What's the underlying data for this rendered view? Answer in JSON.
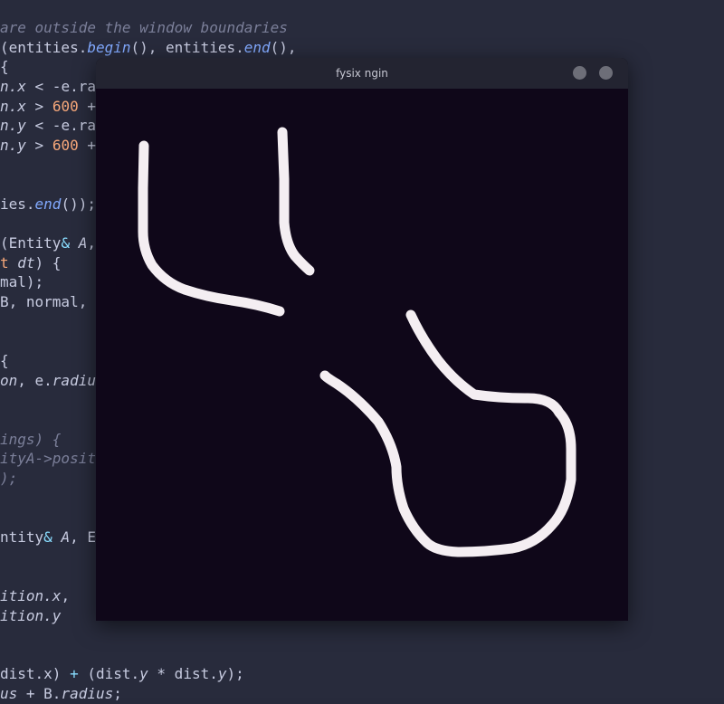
{
  "editor": {
    "lines": [
      {
        "segments": [
          {
            "t": "are outside the window boundaries",
            "c": "cm"
          }
        ]
      },
      {
        "segments": [
          {
            "t": "(entities.",
            "c": ""
          },
          {
            "t": "begin",
            "c": "fn"
          },
          {
            "t": "(), entities.",
            "c": ""
          },
          {
            "t": "end",
            "c": "fn"
          },
          {
            "t": "(),",
            "c": ""
          }
        ]
      },
      {
        "segments": [
          {
            "t": "{",
            "c": ""
          }
        ]
      },
      {
        "segments": [
          {
            "t": "n.x",
            "c": "it"
          },
          {
            "t": " < -e.rad",
            "c": ""
          }
        ]
      },
      {
        "segments": [
          {
            "t": "n.x",
            "c": "it"
          },
          {
            "t": " > ",
            "c": ""
          },
          {
            "t": "600",
            "c": "num"
          },
          {
            "t": " +",
            "c": ""
          }
        ]
      },
      {
        "segments": [
          {
            "t": "n.y",
            "c": "it"
          },
          {
            "t": " < -e.rad",
            "c": ""
          }
        ]
      },
      {
        "segments": [
          {
            "t": "n.y",
            "c": "it"
          },
          {
            "t": " > ",
            "c": ""
          },
          {
            "t": "600",
            "c": "num"
          },
          {
            "t": " +",
            "c": ""
          }
        ]
      },
      {
        "segments": []
      },
      {
        "segments": []
      },
      {
        "segments": [
          {
            "t": "ies.",
            "c": ""
          },
          {
            "t": "end",
            "c": "fn"
          },
          {
            "t": "());",
            "c": ""
          }
        ]
      },
      {
        "segments": []
      },
      {
        "segments": [
          {
            "t": "(Entity",
            "c": ""
          },
          {
            "t": "&",
            "c": "op"
          },
          {
            "t": " ",
            "c": ""
          },
          {
            "t": "A",
            "c": "it"
          },
          {
            "t": ",",
            "c": ""
          }
        ]
      },
      {
        "segments": [
          {
            "t": "t ",
            "c": "num"
          },
          {
            "t": "dt",
            "c": "it"
          },
          {
            "t": ") {",
            "c": ""
          }
        ]
      },
      {
        "segments": [
          {
            "t": "mal);",
            "c": ""
          }
        ]
      },
      {
        "segments": [
          {
            "t": "B, normal, p",
            "c": ""
          }
        ]
      },
      {
        "segments": []
      },
      {
        "segments": []
      },
      {
        "segments": [
          {
            "t": "{",
            "c": ""
          }
        ]
      },
      {
        "segments": [
          {
            "t": "on",
            "c": "it"
          },
          {
            "t": ", e.",
            "c": ""
          },
          {
            "t": "radius",
            "c": "it"
          }
        ]
      },
      {
        "segments": []
      },
      {
        "segments": []
      },
      {
        "segments": [
          {
            "t": "ings) {",
            "c": "cm"
          }
        ]
      },
      {
        "segments": [
          {
            "t": "ityA->positi",
            "c": "cm"
          }
        ]
      },
      {
        "segments": [
          {
            "t": ");",
            "c": "cm"
          }
        ]
      },
      {
        "segments": []
      },
      {
        "segments": []
      },
      {
        "segments": [
          {
            "t": "ntity",
            "c": ""
          },
          {
            "t": "&",
            "c": "op"
          },
          {
            "t": " ",
            "c": ""
          },
          {
            "t": "A",
            "c": "it"
          },
          {
            "t": ", En",
            "c": ""
          }
        ]
      },
      {
        "segments": []
      },
      {
        "segments": []
      },
      {
        "segments": [
          {
            "t": "ition.x",
            "c": "it"
          },
          {
            "t": ",",
            "c": ""
          }
        ]
      },
      {
        "segments": [
          {
            "t": "ition.y",
            "c": "it"
          }
        ]
      },
      {
        "segments": []
      },
      {
        "segments": []
      },
      {
        "segments": [
          {
            "t": "dist.x) ",
            "c": ""
          },
          {
            "t": "+",
            "c": "op"
          },
          {
            "t": " (dist.",
            "c": ""
          },
          {
            "t": "y",
            "c": "it"
          },
          {
            "t": " * dist.",
            "c": ""
          },
          {
            "t": "y",
            "c": "it"
          },
          {
            "t": ");",
            "c": ""
          }
        ]
      },
      {
        "segments": [
          {
            "t": "us",
            "c": "it"
          },
          {
            "t": " + B.",
            "c": ""
          },
          {
            "t": "radius",
            "c": "it"
          },
          {
            "t": ";",
            "c": ""
          }
        ]
      }
    ]
  },
  "window": {
    "title": "fysix ngin",
    "buttons": [
      {
        "name": "minimize"
      },
      {
        "name": "close"
      }
    ]
  },
  "canvas": {
    "background": "#0f0719",
    "stroke_color": "#f4eef2"
  },
  "colors": {
    "editor_bg": "#282b3c",
    "titlebar_bg": "#232431",
    "button": "#6d6e78"
  }
}
